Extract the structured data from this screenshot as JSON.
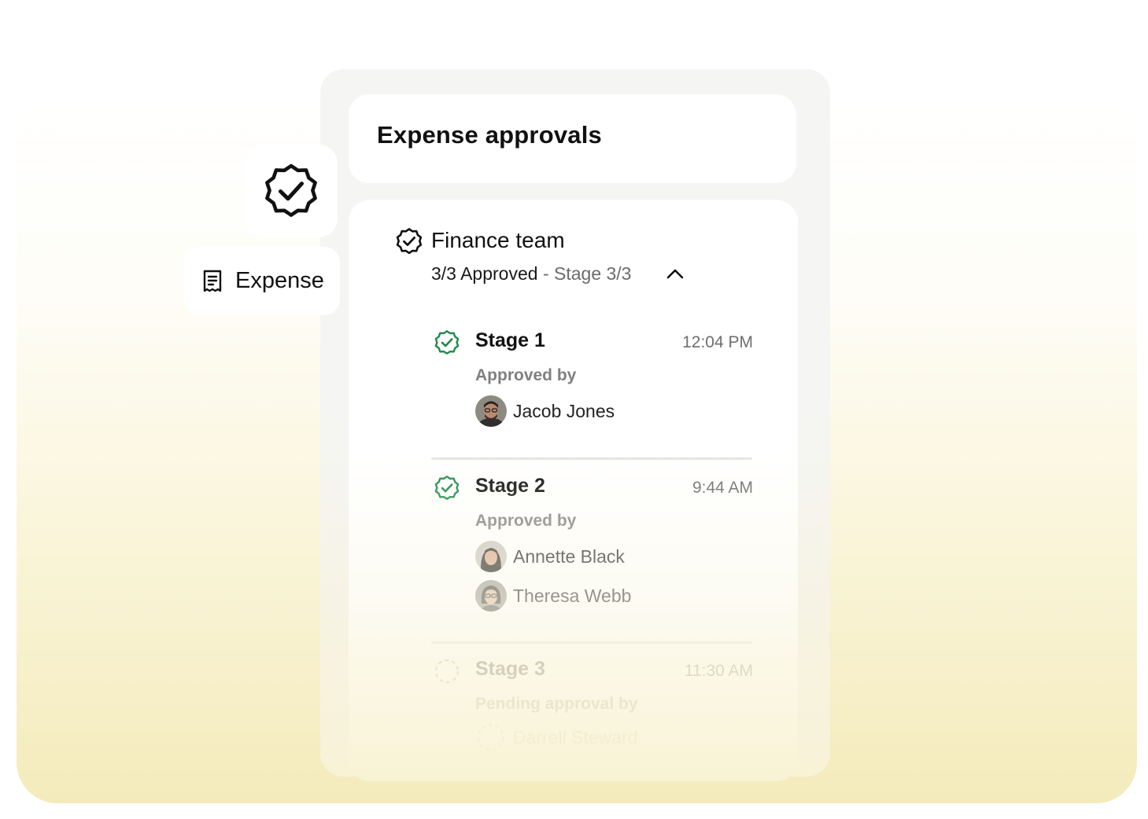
{
  "header": {
    "title": "Expense approvals"
  },
  "floating": {
    "badge_icon": "verified-badge-icon",
    "expense_chip": {
      "icon": "receipt-icon",
      "label": "Expense"
    }
  },
  "group": {
    "icon": "verified-badge-icon",
    "title": "Finance team",
    "approved_text": "3/3 Approved",
    "stage_text": " - Stage 3/3",
    "toggle_icon": "chevron-up-icon"
  },
  "stages": [
    {
      "title": "Stage 1",
      "time": "12:04 PM",
      "status": "approved",
      "approver_label": "Approved by",
      "approvers": [
        {
          "name": "Jacob Jones"
        }
      ]
    },
    {
      "title": "Stage 2",
      "time": "9:44 AM",
      "status": "approved",
      "approver_label": "Approved by",
      "approvers": [
        {
          "name": "Annette Black"
        },
        {
          "name": "Theresa Webb"
        }
      ]
    },
    {
      "title": "Stage 3",
      "time": "11:30 AM",
      "status": "pending",
      "approver_label": "Pending approval by",
      "approvers": [
        {
          "name": "Darrell Steward"
        }
      ]
    }
  ],
  "colors": {
    "approved_green": "#1f8a4c",
    "background_cream": "#f4ebbb",
    "card_grey": "#f4f4f3"
  }
}
